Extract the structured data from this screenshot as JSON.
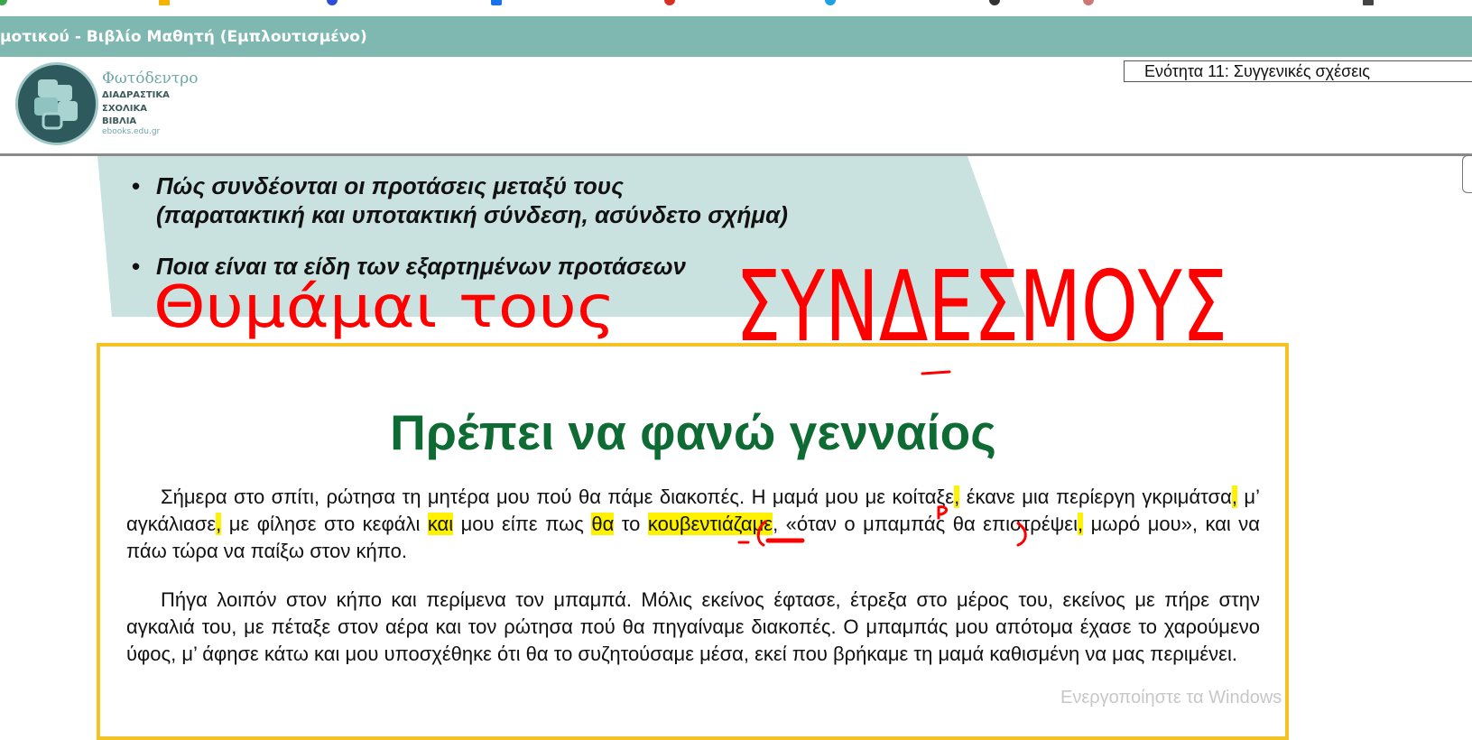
{
  "window": {
    "title": "μοτικού - Βιβλίο Μαθητή (Εμπλουτισμένο)"
  },
  "header": {
    "logo": {
      "title": "Φωτόδεντρο",
      "line1": "ΔΙΑΔΡΑΣΤΙΚΑ",
      "line2": "ΣΧΟΛΙΚΑ",
      "line3": "ΒΙΒΛΙΑ",
      "url": "ebooks.edu.gr"
    },
    "unit_selector": "Ενότητα 11: Συγγενικές σχέσεις"
  },
  "objectives": [
    {
      "line1": "Πώς συνδέονται οι προτάσεις μεταξύ τους",
      "line2": "(παρατακτική και υποτακτική σύνδεση, ασύνδετο σχήμα)"
    },
    {
      "line1": "Ποια είναι τα είδη των εξαρτημένων προτάσεων"
    }
  ],
  "story": {
    "title": "Πρέπει να φανώ γενναίος",
    "p1": {
      "s1": "Σήμερα στο σπίτι, ρώτησα τη μητέρα μου πού θα πάμε διακοπές. Η μαμά μου με κοίταξε",
      "c1": ",",
      "s2": " έκανε μια περίεργη γκριμάτσα",
      "c2": ",",
      "s3": " μ’ αγκάλιασε",
      "c3": ",",
      "s4": " με φίλησε στο κεφάλι ",
      "w1": "και",
      "s5": " μου είπε ",
      "w2": "πως",
      "s6": " ",
      "w3": "θα",
      "s7": " το ",
      "w4": "κουβεντιάζαμε",
      "s8": ", «όταν ο μπαμπάς θα επιστρέψει",
      "c4": ",",
      "s9": " μωρό μου», και να πάω τώρα να παίξω στον κήπο."
    },
    "p2": "Πήγα λοιπόν στον κήπο και περίμενα τον μπαμπά. Μόλις εκείνος έφτασε, έτρεξα στο μέρος του, εκείνος με πήρε στην αγκαλιά του, με πέταξε στον αέρα και τον ρώτησα πού θα πηγαίναμε διακοπές. Ο μπαμπάς μου απότομα έχασε το χαρούμενο ύφος, μ’ άφησε κάτω και μου υποσχέθηκε ότι θα το συζητούσαμε μέσα, εκεί που βρήκαμε τη μαμά καθισμένη να μας περιμένει."
  },
  "annotations": {
    "left": "Θυμάμαι τους",
    "right": "ΣΥΝΔΕΣΜΟΥΣ",
    "ink_color": "#ff0000",
    "highlight_color": "#fff200"
  },
  "watermark": "Ενεργοποίηστε τα Windows",
  "colors": {
    "titlebar": "#7fb8b0",
    "band": "#c9e2df",
    "story_border": "#f3c324",
    "title_green": "#0e6b33"
  }
}
